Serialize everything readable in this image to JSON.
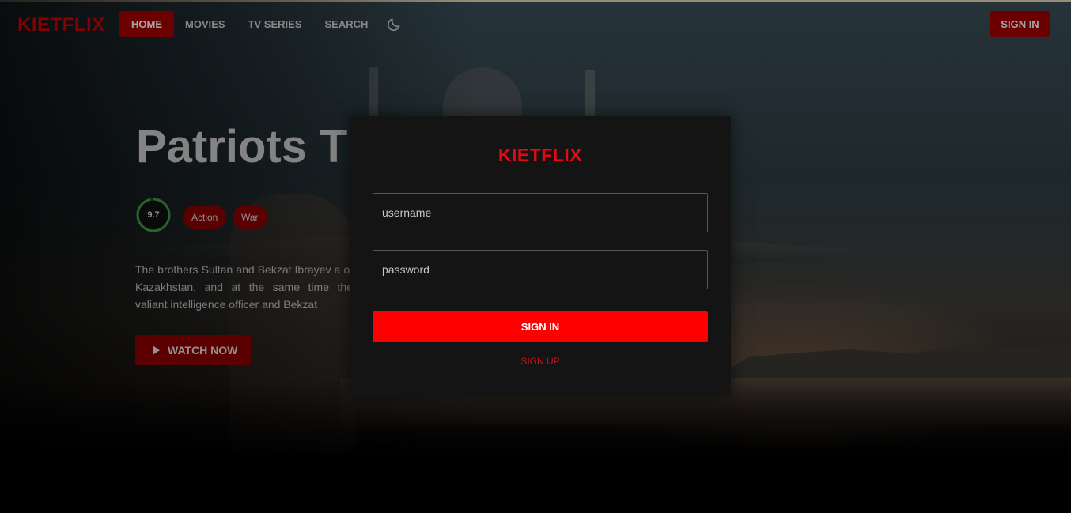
{
  "brand": "KIETFLIX",
  "nav": {
    "items": [
      {
        "label": "HOME",
        "active": true
      },
      {
        "label": "MOVIES",
        "active": false
      },
      {
        "label": "TV SERIES",
        "active": false
      },
      {
        "label": "SEARCH",
        "active": false
      }
    ],
    "theme_icon": "moon-icon",
    "signin_label": "SIGN IN"
  },
  "hero": {
    "title": "Patriots Ti",
    "rating": "9.7",
    "rating_fraction": 0.97,
    "genres": [
      "Action",
      "War"
    ],
    "overview": "The brothers Sultan and Bekzat Ibrayev a of Kazakhstan, and at the same time the valiant intelligence officer and Bekzat",
    "watch_label": "WATCH NOW",
    "play_icon": "play-icon"
  },
  "modal": {
    "brand": "KIETFLIX",
    "username_placeholder": "username",
    "password_placeholder": "password",
    "signin_label": "SIGN IN",
    "signup_label": "SIGN UP"
  },
  "colors": {
    "brand_red": "#e50914",
    "nav_active": "#a30000",
    "button_red": "#ff0000",
    "modal_bg": "#141414"
  }
}
